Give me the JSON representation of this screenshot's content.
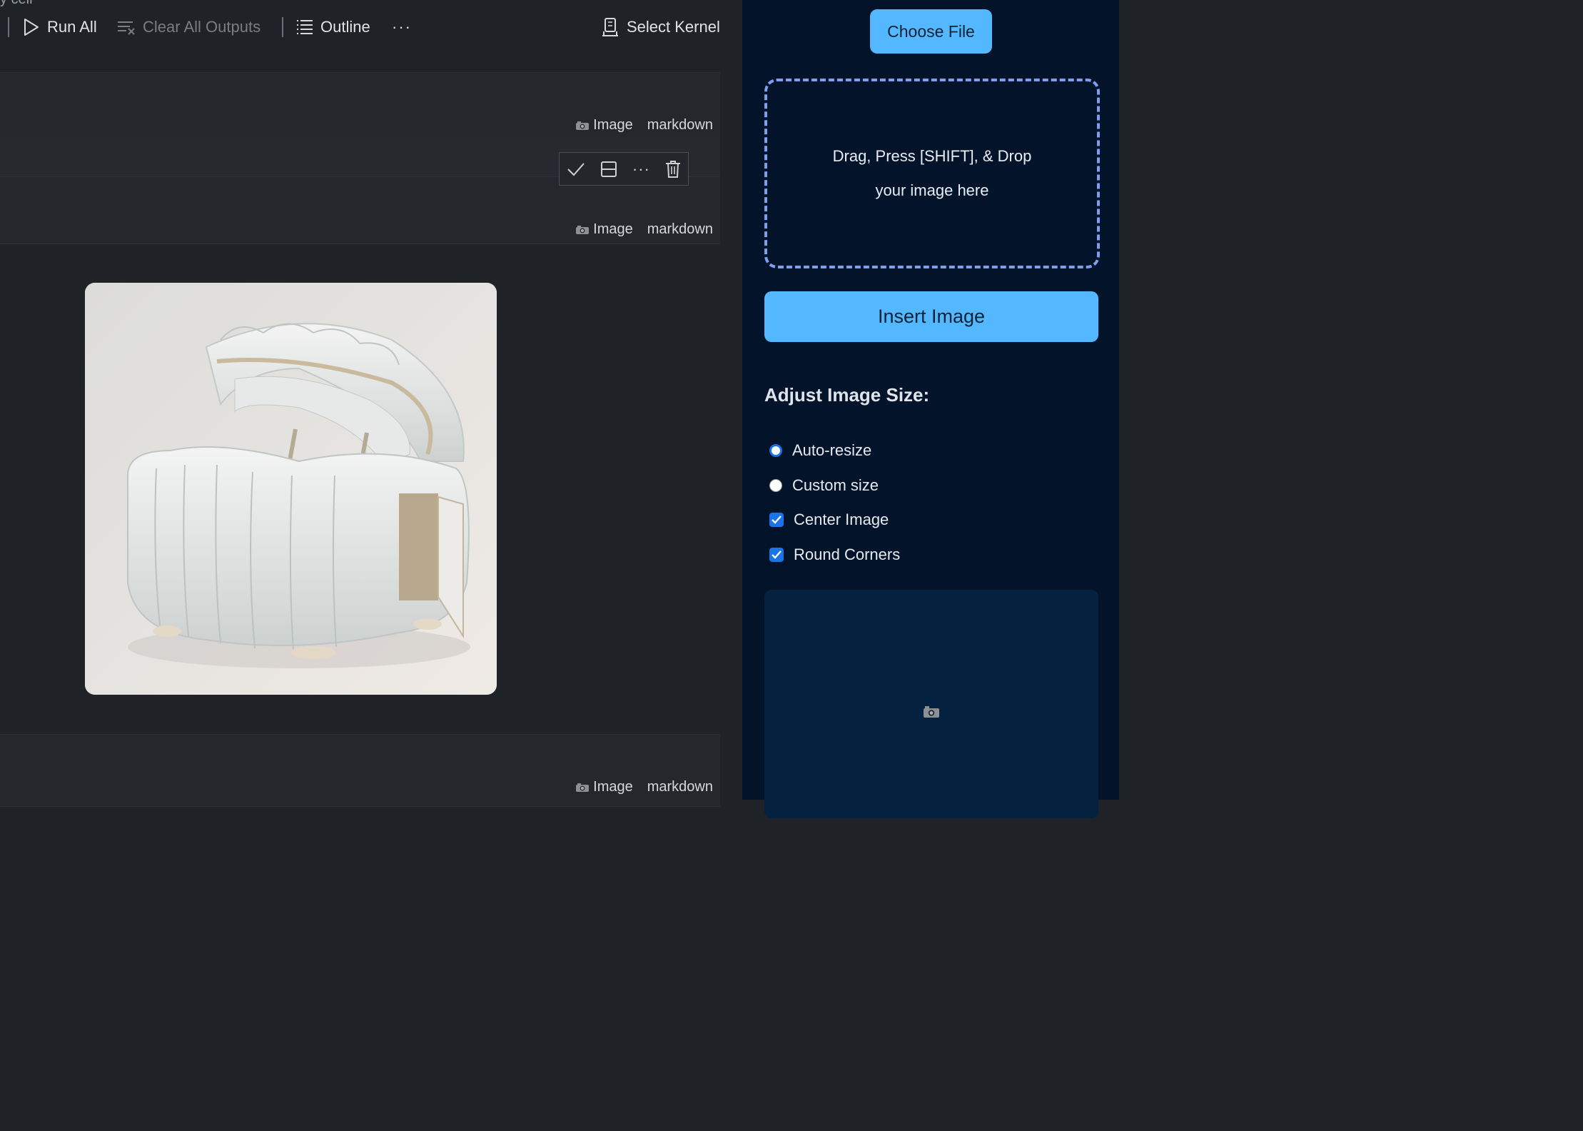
{
  "toolbar": {
    "run_all": "Run All",
    "clear_outputs": "Clear All Outputs",
    "outline": "Outline",
    "more": "···",
    "select_kernel": "Select Kernel",
    "cut_text": "y cell"
  },
  "cells": [
    {
      "tag_image": "Image",
      "tag_lang": "markdown"
    },
    {
      "tag_image": "Image",
      "tag_lang": "markdown"
    },
    {
      "tag_image": "Image",
      "tag_lang": "markdown"
    }
  ],
  "cell_actions": {
    "more": "···"
  },
  "output_image": {
    "alt": "white upholstered storage ottoman with lid open"
  },
  "panel": {
    "choose_file": "Choose File",
    "drop_line1": "Drag, Press [SHIFT], & Drop",
    "drop_line2": "your image here",
    "insert_image": "Insert Image",
    "size_title": "Adjust Image Size:",
    "options": [
      {
        "label": "Auto-resize",
        "type": "radio",
        "selected": true
      },
      {
        "label": "Custom size",
        "type": "radio",
        "selected": false
      },
      {
        "label": "Center Image",
        "type": "checkbox",
        "checked": true
      },
      {
        "label": "Round Corners",
        "type": "checkbox",
        "checked": true
      }
    ]
  },
  "colors": {
    "accent_button": "#53b8ff",
    "panel_bg": "#03142a",
    "dropzone_border": "#7f9ef0",
    "checkbox": "#1a73e8"
  }
}
